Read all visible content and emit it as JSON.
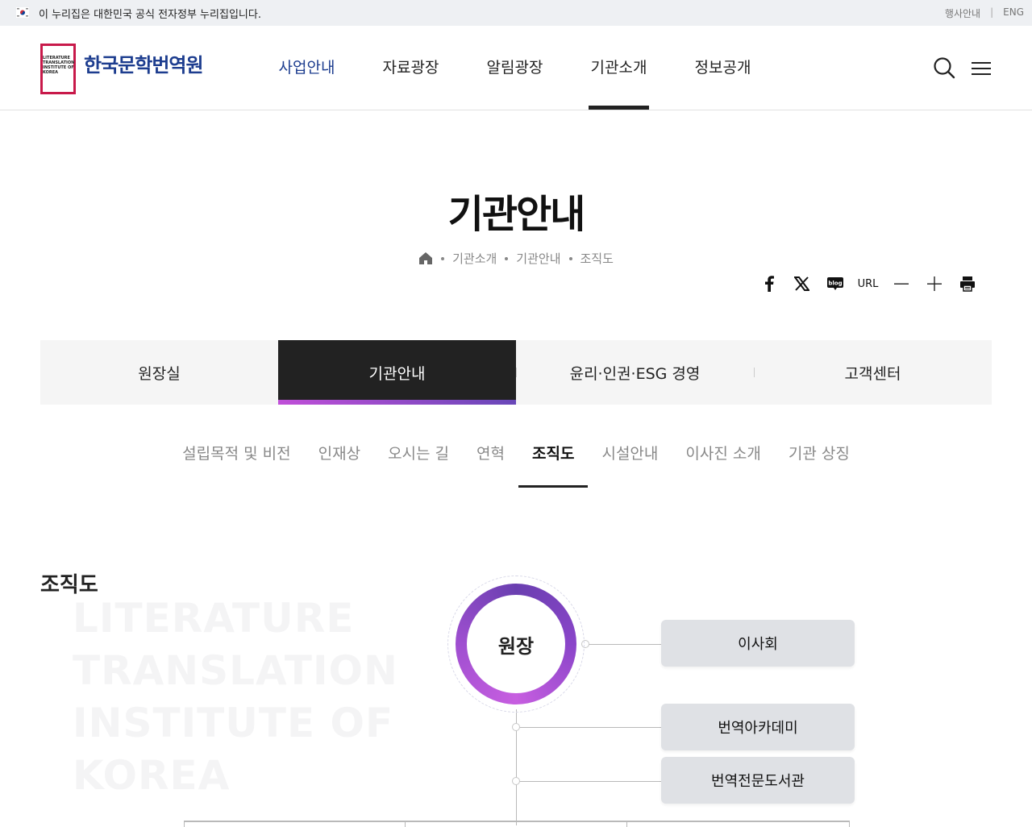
{
  "gov_bar": {
    "text": "이 누리집은 대한민국 공식 전자정부 누리집입니다.",
    "links": [
      "행사안내",
      "ENG"
    ]
  },
  "header": {
    "logo_small": [
      "LITERATURE",
      "TRANSLATION",
      "INSTITUTE OF",
      "KOREA"
    ],
    "logo_name": "한국문학번역원",
    "nav": [
      "사업안내",
      "자료광장",
      "알림광장",
      "기관소개",
      "정보공개"
    ],
    "nav_current": "사업안내",
    "nav_active": "기관소개",
    "icons": [
      "search-icon",
      "hamburger-menu-icon"
    ]
  },
  "page": {
    "title": "기관안내",
    "breadcrumb": [
      "기관소개",
      "기관안내",
      "조직도"
    ],
    "share": {
      "icons": [
        "facebook-icon",
        "x-icon",
        "blog-icon"
      ],
      "url_label": "URL",
      "tools": [
        "zoom-out-icon",
        "zoom-in-icon",
        "print-icon"
      ],
      "blog_text": "blog"
    }
  },
  "tabs": [
    "원장실",
    "기관안내",
    "윤리·인권·ESG 경영",
    "고객센터"
  ],
  "tabs_active": "기관안내",
  "subtabs": [
    "설립목적 및 비전",
    "인재상",
    "오시는 길",
    "연혁",
    "조직도",
    "시설안내",
    "이사진 소개",
    "기관 상징"
  ],
  "subtabs_active": "조직도",
  "org": {
    "section_title": "조직도",
    "watermark": [
      "LITERATURE",
      "TRANSLATION",
      "INSTITUTE OF",
      "KOREA"
    ],
    "director": "원장",
    "board": "이사회",
    "academy": "번역아카데미",
    "library": "번역전문도서관"
  },
  "colors": {
    "brand_blue": "#1d3d8f",
    "brand_red": "#c8194a",
    "accent_gradient": [
      "#c04fd8",
      "#6847b8"
    ]
  }
}
